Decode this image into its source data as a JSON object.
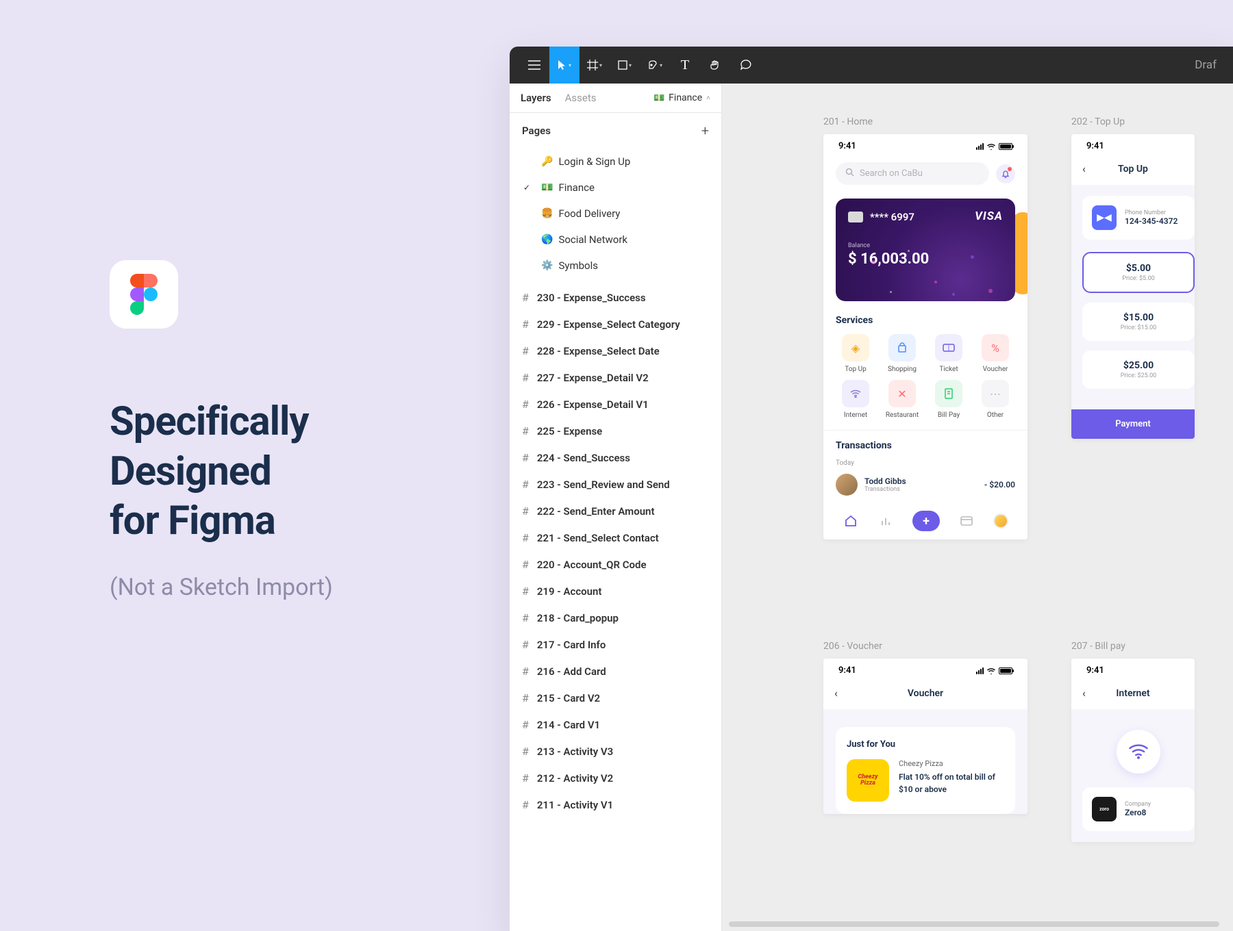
{
  "marketing": {
    "headline_l1": "Specifically",
    "headline_l2": "Designed",
    "headline_l3": "for Figma",
    "subhead": "(Not a Sketch Import)"
  },
  "toolbar": {
    "right_label": "Draf"
  },
  "panel": {
    "tab_layers": "Layers",
    "tab_assets": "Assets",
    "current_page": "Finance",
    "pages_header": "Pages",
    "pages": [
      {
        "emoji": "🔑",
        "name": "Login & Sign Up",
        "active": false
      },
      {
        "emoji": "💵",
        "name": "Finance",
        "active": true
      },
      {
        "emoji": "🍔",
        "name": "Food Delivery",
        "active": false
      },
      {
        "emoji": "🌎",
        "name": "Social Network",
        "active": false
      },
      {
        "emoji": "⚙️",
        "name": "Symbols",
        "active": false
      }
    ],
    "layers": [
      "230 - Expense_Success",
      "229 - Expense_Select Category",
      "228 - Expense_Select Date",
      "227 - Expense_Detail V2",
      "226 - Expense_Detail V1",
      "225 - Expense",
      "224 - Send_Success",
      "223 - Send_Review and Send",
      "222 - Send_Enter Amount",
      "221 - Send_Select Contact",
      "220 - Account_QR Code",
      "219 - Account",
      "218 - Card_popup",
      "217 - Card Info",
      "216 - Add Card",
      "215 - Card V2",
      "214 - Card V1",
      "213 - Activity V3",
      "212 - Activity V2",
      "211 - Activity V1"
    ]
  },
  "artboards": {
    "a201": {
      "label": "201 - Home",
      "time": "9:41",
      "search_placeholder": "Search on CaBu",
      "card": {
        "number": "**** 6997",
        "brand": "VISA",
        "balance_label": "Balance",
        "balance": "$ 16,003.00"
      },
      "services_title": "Services",
      "services": [
        {
          "label": "Top Up"
        },
        {
          "label": "Shopping"
        },
        {
          "label": "Ticket"
        },
        {
          "label": "Voucher"
        },
        {
          "label": "Internet"
        },
        {
          "label": "Restaurant"
        },
        {
          "label": "Bill Pay"
        },
        {
          "label": "Other"
        }
      ],
      "tx_title": "Transactions",
      "tx_sub": "Today",
      "tx": {
        "name": "Todd Gibbs",
        "type": "Transactions",
        "amount": "- $20.00"
      }
    },
    "a202": {
      "label": "202 - Top Up",
      "time": "9:41",
      "title": "Top Up",
      "phone_label": "Phone Number",
      "phone_number": "124-345-4372",
      "amounts": [
        {
          "value": "$5.00",
          "price": "Price: $5.00",
          "active": true
        },
        {
          "value": "$15.00",
          "price": "Price: $15.00",
          "active": false
        },
        {
          "value": "$25.00",
          "price": "Price: $25.00",
          "active": false
        }
      ],
      "pay_label": "Payment"
    },
    "a206": {
      "label": "206 - Voucher",
      "time": "9:41",
      "title": "Voucher",
      "jfy_title": "Just for You",
      "deal": {
        "thumb_text": "Cheezy\nPizza",
        "name": "Cheezy Pizza",
        "desc": "Flat 10% off on total bill of $10 or above"
      }
    },
    "a207": {
      "label": "207 - Bill pay",
      "time": "9:41",
      "title": "Internet",
      "company_label": "Company",
      "company_name": "Zero8",
      "company_logo_text": "zoro"
    }
  }
}
